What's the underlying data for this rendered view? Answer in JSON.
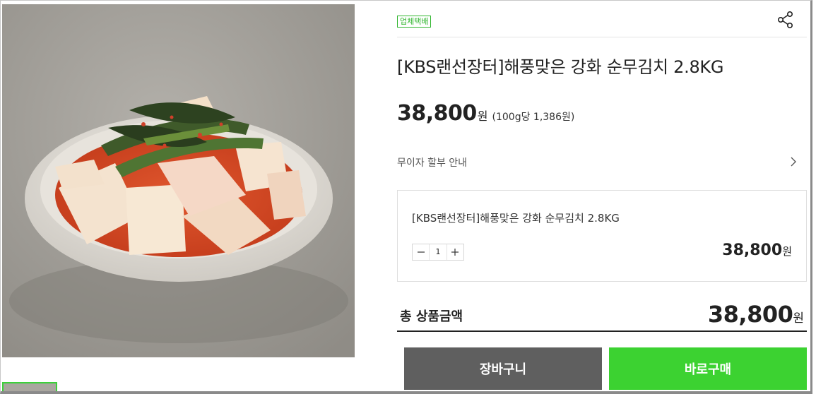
{
  "product": {
    "delivery_tag": "업체택배",
    "title": "[KBS랜선장터]해풍맞은 강화 순무김치 2.8KG",
    "price": "38,800",
    "currency": "원",
    "unit_price": "(100g당 1,386원)",
    "image_icon": "kimchi-photo"
  },
  "installment": {
    "label": "무이자 할부 안내"
  },
  "option": {
    "name": "[KBS랜선장터]해풍맞은 강화 순무김치 2.8KG",
    "quantity": "1",
    "price": "38,800",
    "currency": "원"
  },
  "total": {
    "label": "총 상품금액",
    "price": "38,800",
    "currency": "원"
  },
  "buttons": {
    "cart": "장바구니",
    "buy": "바로구매"
  },
  "colors": {
    "accent_green": "#3cd231",
    "cart_gray": "#5f5f5f"
  }
}
